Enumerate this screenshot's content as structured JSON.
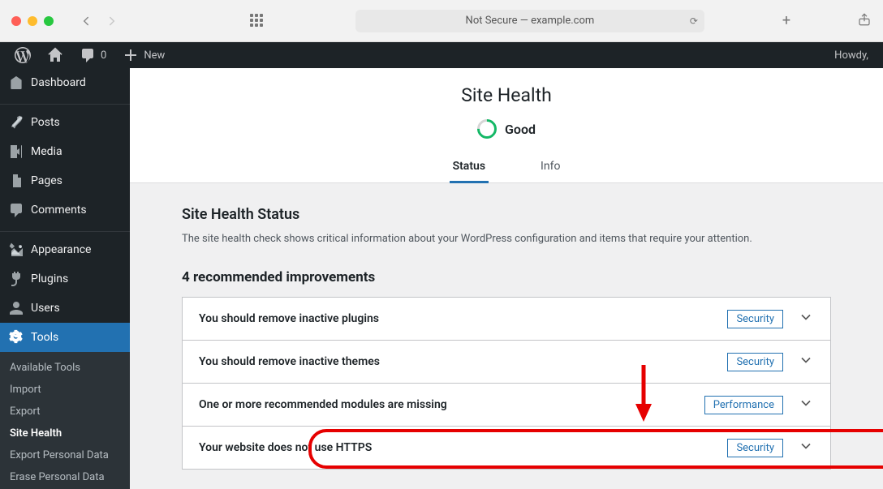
{
  "browser": {
    "address": "Not Secure — example.com"
  },
  "toolbar": {
    "comments_count": "0",
    "new_label": "New",
    "greeting": "Howdy,"
  },
  "sidebar": {
    "items": [
      {
        "label": "Dashboard"
      },
      {
        "label": "Posts"
      },
      {
        "label": "Media"
      },
      {
        "label": "Pages"
      },
      {
        "label": "Comments"
      },
      {
        "label": "Appearance"
      },
      {
        "label": "Plugins"
      },
      {
        "label": "Users"
      },
      {
        "label": "Tools"
      }
    ],
    "submenu": [
      {
        "label": "Available Tools"
      },
      {
        "label": "Import"
      },
      {
        "label": "Export"
      },
      {
        "label": "Site Health"
      },
      {
        "label": "Export Personal Data"
      },
      {
        "label": "Erase Personal Data"
      }
    ]
  },
  "page": {
    "title": "Site Health",
    "status_text": "Good",
    "tabs": [
      {
        "label": "Status"
      },
      {
        "label": "Info"
      }
    ],
    "status_section_title": "Site Health Status",
    "status_section_desc": "The site health check shows critical information about your WordPress configuration and items that require your attention.",
    "recommendations_title": "4 recommended improvements",
    "items": [
      {
        "label": "You should remove inactive plugins",
        "badge": "Security"
      },
      {
        "label": "You should remove inactive themes",
        "badge": "Security"
      },
      {
        "label": "One or more recommended modules are missing",
        "badge": "Performance"
      },
      {
        "label": "Your website does not use HTTPS",
        "badge": "Security"
      }
    ]
  }
}
